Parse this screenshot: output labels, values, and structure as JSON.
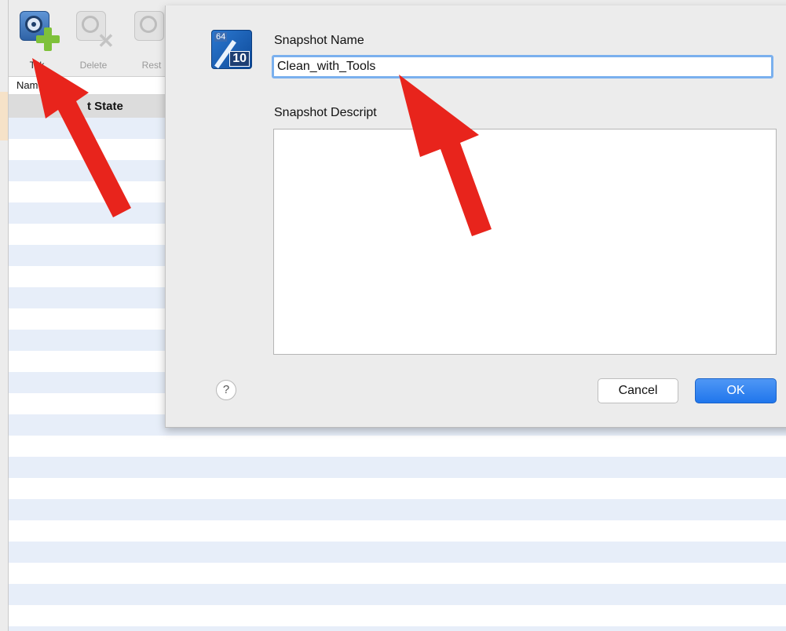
{
  "toolbar": {
    "take_label": "Tak",
    "delete_label": "Delete",
    "restore_label": "Rest"
  },
  "list": {
    "header_name": "Nam",
    "current_state": "t State"
  },
  "dialog": {
    "snapshot_name_label": "Snapshot Name",
    "snapshot_name_value": "Clean_with_Tools",
    "snapshot_description_label": "Snapshot Descript",
    "snapshot_description_value": "",
    "vm_badge_top": "64",
    "vm_badge_bottom": "10",
    "help_label": "?",
    "cancel_label": "Cancel",
    "ok_label": "OK"
  },
  "colors": {
    "arrow": "#e8241c",
    "ok_button": "#2a7ded",
    "focus_ring": "#7ab0ee",
    "stripe": "#e7eef9"
  },
  "icons": [
    "take-snapshot-icon",
    "delete-snapshot-icon",
    "restore-snapshot-icon",
    "vm-os-icon",
    "help-icon"
  ]
}
